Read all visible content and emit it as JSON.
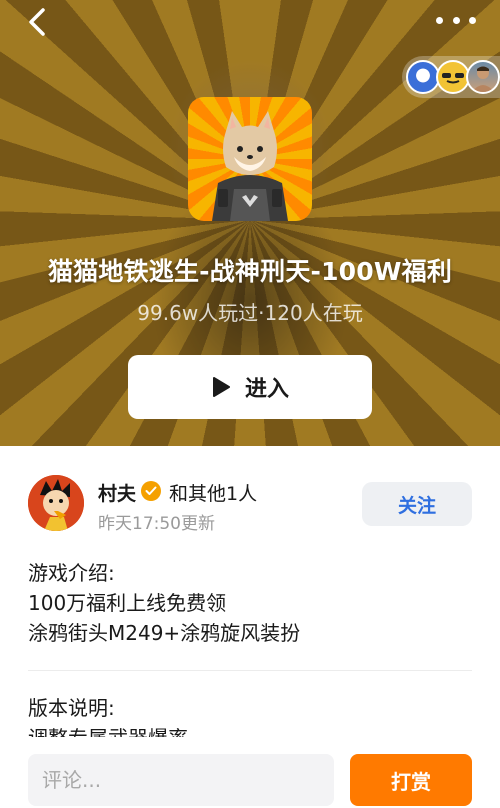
{
  "header": {
    "back_icon": "chevron-left-icon",
    "more_icon": "more-dots-icon"
  },
  "players_avatars": [
    "player-avatar-1",
    "player-avatar-2",
    "player-avatar-3"
  ],
  "game": {
    "title": "猫猫地铁逃生-战神刑天-100W福利",
    "stats": "99.6w人玩过·120人在玩",
    "enter_label": "进入",
    "enter_icon": "play-icon"
  },
  "author": {
    "name": "村夫",
    "verified_icon": "verified-badge-icon",
    "co_authors": "和其他1人",
    "update_time": "昨天17:50更新",
    "follow_label": "关注"
  },
  "intro": {
    "heading": "游戏介绍:",
    "lines": [
      "100万福利上线免费领",
      "涂鸦街头M249+涂鸦旋风装扮"
    ]
  },
  "version": {
    "heading": "版本说明:",
    "line1": "调整专属武器爆率"
  },
  "bottom": {
    "comment_placeholder": "评论...",
    "reward_label": "打赏"
  },
  "colors": {
    "accent_orange": "#ff7a00",
    "follow_blue": "#2f6fe0",
    "verified_gold": "#f5a000"
  }
}
